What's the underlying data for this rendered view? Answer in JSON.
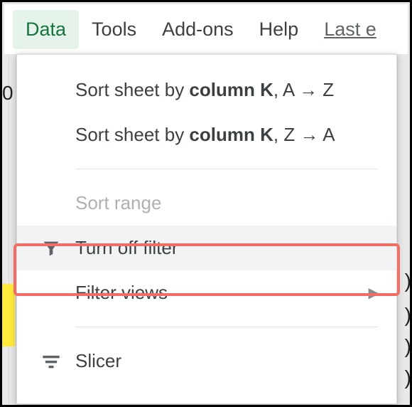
{
  "menubar": {
    "data": "Data",
    "tools": "Tools",
    "addons": "Add-ons",
    "help": "Help",
    "last_edit": "Last e"
  },
  "bg": {
    "partial_zero": "0"
  },
  "dropdown": {
    "sort_asc_prefix": "Sort sheet by ",
    "sort_asc_col": "column K",
    "sort_asc_suffix": ", A → Z",
    "sort_desc_prefix": "Sort sheet by ",
    "sort_desc_col": "column K",
    "sort_desc_suffix": ", Z → A",
    "sort_range": "Sort range",
    "turn_off_filter": "Turn off filter",
    "filter_views": "Filter views",
    "slicer": "Slicer"
  }
}
